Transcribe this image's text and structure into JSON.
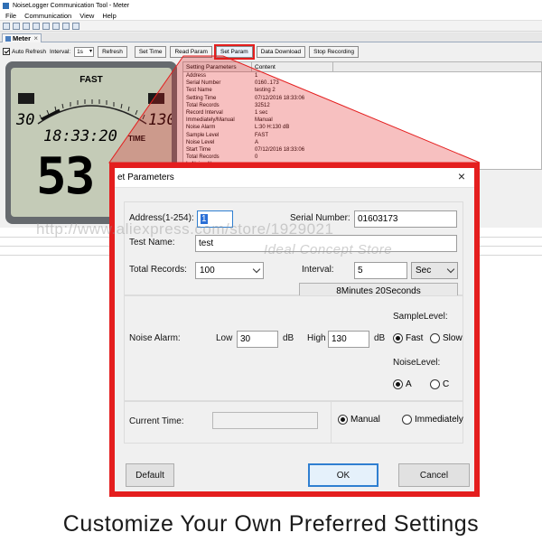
{
  "app": {
    "title": "NoiseLogger Communication Tool - Meter",
    "menu": [
      "File",
      "Communication",
      "View",
      "Help"
    ],
    "tab": "Meter",
    "controls": {
      "auto_refresh": "Auto Refresh",
      "interval_label": "Interval:",
      "interval_value": "1s",
      "buttons": [
        "Refresh",
        "Set Time",
        "Read Param",
        "Set Param",
        "Data Download",
        "Stop Recording"
      ]
    },
    "meter": {
      "mode": "FAST",
      "scale_low": "30",
      "scale_high": "130",
      "clock": "18:33:20",
      "time_label": "TIME",
      "reading": "53"
    },
    "param_table": {
      "headers": [
        "Setting Parameters",
        "Content"
      ],
      "rows": [
        [
          "Address",
          "1"
        ],
        [
          "Serial Number",
          "0160..173"
        ],
        [
          "Test Name",
          "testing 2"
        ],
        [
          "Setting Time",
          "07/12/2016 18:33:06"
        ],
        [
          "Total Records",
          "32512"
        ],
        [
          "Record Interval",
          "1 sec"
        ],
        [
          "Immediately/Manual",
          "Manual"
        ],
        [
          "Noise Alarm",
          "L:30 H:130 dB"
        ],
        [
          "Sample Level",
          "FAST"
        ],
        [
          "Noise Level",
          "A"
        ],
        [
          "Start Time",
          "07/12/2016 18:33:06"
        ],
        [
          "Total Records",
          "0"
        ],
        [
          "Is Noise Alarm",
          ""
        ]
      ]
    }
  },
  "dialog": {
    "title": "et Parameters",
    "close": "×",
    "address_label": "Address(1-254):",
    "address_value": "1",
    "serial_label": "Serial Number:",
    "serial_value": "01603173",
    "testname_label": "Test Name:",
    "testname_value": "test",
    "total_records_label": "Total Records:",
    "total_records_value": "100",
    "interval_label": "Interval:",
    "interval_value": "5",
    "interval_unit": "Sec",
    "duration": "8Minutes 20Seconds",
    "noise_alarm_label": "Noise Alarm:",
    "low_label": "Low",
    "low_value": "30",
    "high_label": "High",
    "high_value": "130",
    "db_unit": "dB",
    "sample_level_label": "SampleLevel:",
    "sample_fast": "Fast",
    "sample_slow": "Slow",
    "noise_level_label": "NoiseLevel:",
    "noise_a": "A",
    "noise_c": "C",
    "current_time_label": "Current Time:",
    "current_time_value": "",
    "manual": "Manual",
    "immediately": "Immediately",
    "default_button": "Default",
    "ok_button": "OK",
    "cancel_button": "Cancel"
  },
  "watermark": {
    "line1": "http://www.aliexpress.com/store/1929021",
    "line2": "Ideal Concept Store"
  },
  "caption": "Customize Your Own Preferred Settings",
  "colors": {
    "highlight": "#e41e1e",
    "focus": "#2f7fd1"
  }
}
